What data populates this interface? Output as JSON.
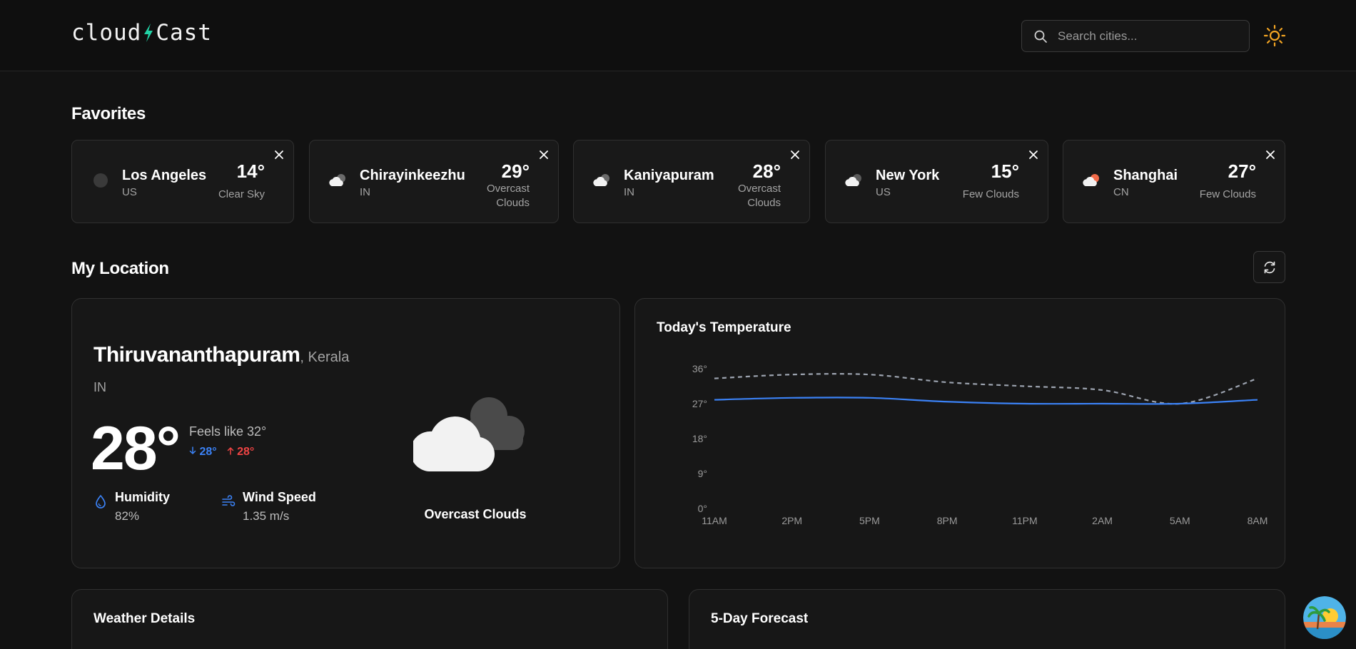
{
  "header": {
    "logo_left": "cloud",
    "logo_right": "Cast",
    "search_placeholder": "Search cities..."
  },
  "favorites": {
    "title": "Favorites",
    "items": [
      {
        "name": "Los Angeles",
        "country": "US",
        "temp": "14°",
        "desc": "Clear Sky",
        "icon": "clear-night-icon"
      },
      {
        "name": "Chirayinkeezhu",
        "country": "IN",
        "temp": "29°",
        "desc": "Overcast Clouds",
        "icon": "overcast-clouds-icon"
      },
      {
        "name": "Kaniyapuram",
        "country": "IN",
        "temp": "28°",
        "desc": "Overcast Clouds",
        "icon": "overcast-clouds-icon"
      },
      {
        "name": "New York",
        "country": "US",
        "temp": "15°",
        "desc": "Few Clouds",
        "icon": "few-clouds-night-icon"
      },
      {
        "name": "Shanghai",
        "country": "CN",
        "temp": "27°",
        "desc": "Few Clouds",
        "icon": "few-clouds-day-icon"
      }
    ]
  },
  "my_location": {
    "title": "My Location",
    "city": "Thiruvananthapuram",
    "region": "Kerala",
    "country": "IN",
    "temp": "28°",
    "feels_like": "Feels like 32°",
    "temp_min": "28°",
    "temp_max": "28°",
    "humidity_label": "Humidity",
    "humidity_value": "82%",
    "wind_label": "Wind Speed",
    "wind_value": "1.35 m/s",
    "condition": "Overcast Clouds"
  },
  "chart_data": {
    "type": "line",
    "title": "Today's Temperature",
    "categories": [
      "11AM",
      "2PM",
      "5PM",
      "8PM",
      "11PM",
      "2AM",
      "5AM",
      "8AM"
    ],
    "y_ticks": [
      "0°",
      "9°",
      "18°",
      "27°",
      "36°"
    ],
    "ylim": [
      0,
      36
    ],
    "grid": false,
    "series": [
      {
        "values": [
          28,
          28.5,
          28.5,
          27.5,
          27,
          27,
          27,
          28
        ],
        "color": "#3b82f6",
        "style": "solid"
      },
      {
        "values": [
          33.5,
          34.5,
          34.5,
          32.5,
          31.5,
          30.5,
          27,
          33.5
        ],
        "color": "#9ca3af",
        "style": "dashed"
      }
    ]
  },
  "weather_details": {
    "title": "Weather Details"
  },
  "forecast": {
    "title": "5-Day Forecast"
  },
  "colors": {
    "background": "#121212",
    "card": "#171717",
    "accent_blue": "#3b82f6",
    "accent_red": "#ef4444",
    "sun": "#f5a623"
  }
}
